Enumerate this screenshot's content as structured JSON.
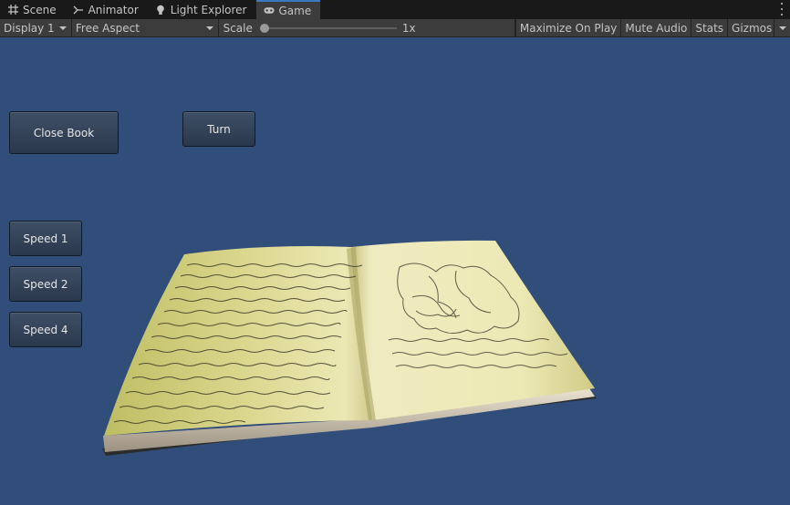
{
  "tabs": [
    {
      "label": "Scene",
      "icon": "grid-icon"
    },
    {
      "label": "Animator",
      "icon": "animator-icon"
    },
    {
      "label": "Light Explorer",
      "icon": "lightbulb-icon"
    },
    {
      "label": "Game",
      "icon": "gamepad-icon",
      "active": true
    }
  ],
  "toolbar": {
    "display": "Display 1",
    "aspect": "Free Aspect",
    "scale_label": "Scale",
    "scale_value": "1x",
    "scale_fraction": 0.0,
    "maximize": "Maximize On Play",
    "mute": "Mute Audio",
    "stats": "Stats",
    "gizmos": "Gizmos"
  },
  "game": {
    "close_book": "Close Book",
    "turn": "Turn",
    "speed1": "Speed 1",
    "speed2": "Speed 2",
    "speed4": "Speed 4"
  },
  "colors": {
    "game_background": "#314d79",
    "active_tab_accent": "#3a79bb",
    "page": "#e7e3a6"
  }
}
